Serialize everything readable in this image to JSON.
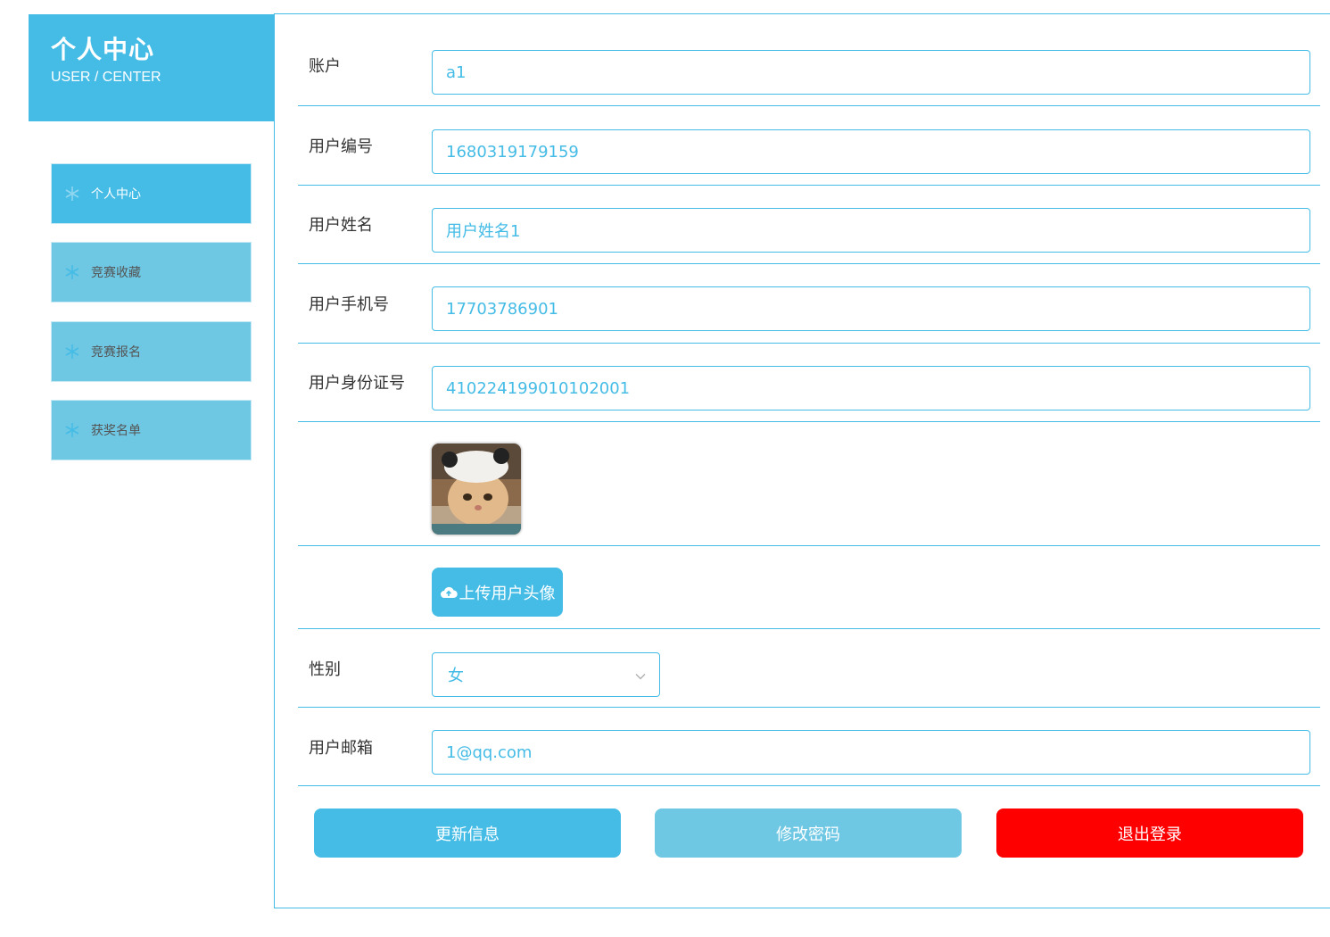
{
  "sidebar": {
    "title": "个人中心",
    "subtitle": "USER / CENTER",
    "items": [
      {
        "label": "个人中心",
        "active": true,
        "icon": "snowflake-icon"
      },
      {
        "label": "竞赛收藏",
        "active": false,
        "icon": "snowflake-icon"
      },
      {
        "label": "竞赛报名",
        "active": false,
        "icon": "snowflake-icon"
      },
      {
        "label": "获奖名单",
        "active": false,
        "icon": "snowflake-icon"
      }
    ]
  },
  "form": {
    "account": {
      "label": "账户",
      "value": "a1"
    },
    "user_no": {
      "label": "用户编号",
      "value": "1680319179159"
    },
    "user_name": {
      "label": "用户姓名",
      "value": "用户姓名1"
    },
    "phone": {
      "label": "用户手机号",
      "value": "17703786901"
    },
    "id_card": {
      "label": "用户身份证号",
      "value": "410224199010102001"
    },
    "upload_label": "上传用户头像",
    "gender": {
      "label": "性别",
      "value": "女"
    },
    "email": {
      "label": "用户邮箱",
      "value": "1@qq.com"
    }
  },
  "actions": {
    "update": "更新信息",
    "change_password": "修改密码",
    "logout": "退出登录"
  },
  "colors": {
    "primary": "#45bce6",
    "secondary": "#6ec7e3",
    "danger": "#ff0000"
  }
}
